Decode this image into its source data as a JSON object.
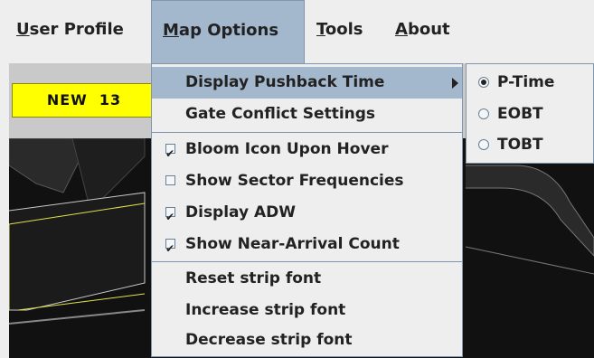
{
  "menubar": {
    "items": [
      {
        "underline": "U",
        "rest": "ser Profile"
      },
      {
        "underline": "M",
        "rest": "ap Options"
      },
      {
        "underline": "T",
        "rest": "ools"
      },
      {
        "underline": "A",
        "rest": "bout"
      }
    ]
  },
  "toolstrip": {
    "badge": "NEW  13",
    "badge_color": "#ffff00"
  },
  "map_options_menu": {
    "items": [
      {
        "label": "Display Pushback Time",
        "submenu": true,
        "highlighted": true
      },
      {
        "label": "Gate Conflict Settings"
      },
      {
        "label": "Bloom Icon Upon Hover",
        "checked": true
      },
      {
        "label": "Show Sector Frequencies",
        "checked": false
      },
      {
        "label": "Display ADW",
        "checked": true
      },
      {
        "label": "Show Near-Arrival Count",
        "checked": true
      },
      {
        "label": "Reset strip font"
      },
      {
        "label": "Increase strip font"
      },
      {
        "label": "Decrease strip font"
      }
    ]
  },
  "pushback_submenu": {
    "options": [
      {
        "label": "P-Time",
        "selected": true
      },
      {
        "label": "EOBT",
        "selected": false
      },
      {
        "label": "TOBT",
        "selected": false
      }
    ]
  },
  "colors": {
    "highlight": "#a3b8cc",
    "map_background": "#111111",
    "taxiway_line": "#e6e04a"
  }
}
